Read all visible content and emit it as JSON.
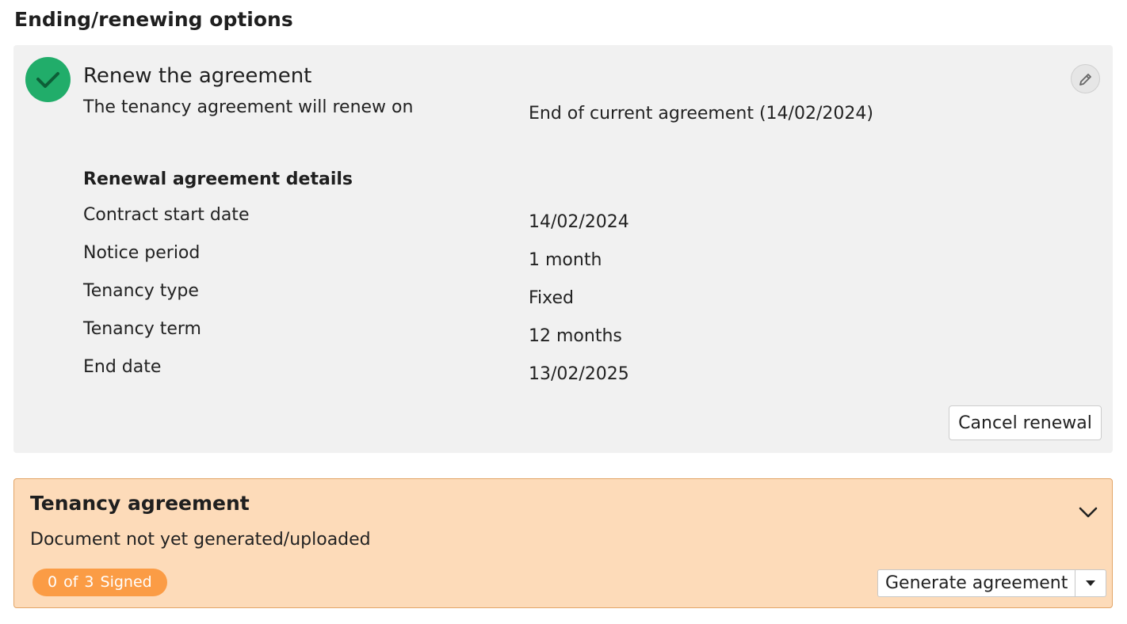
{
  "page": {
    "title": "Ending/renewing options"
  },
  "renewal": {
    "title": "Renew the agreement",
    "status_icon": "check-icon",
    "edit_icon": "pencil-icon",
    "renew_on_label": "The tenancy agreement will renew on",
    "renew_on_value": "End of current agreement (14/02/2024)",
    "details_heading": "Renewal agreement details",
    "rows": [
      {
        "label": "Contract start date",
        "value": "14/02/2024"
      },
      {
        "label": "Notice period",
        "value": "1 month"
      },
      {
        "label": "Tenancy type",
        "value": "Fixed"
      },
      {
        "label": "Tenancy term",
        "value": "12 months"
      },
      {
        "label": "End date",
        "value": "13/02/2025"
      }
    ],
    "cancel_label": "Cancel renewal"
  },
  "agreement": {
    "title": "Tenancy agreement",
    "status": "Document not yet generated/uploaded",
    "expand_icon": "chevron-down-icon",
    "badge": {
      "signed_count": "0",
      "of": "of",
      "total": "3",
      "label": "Signed"
    },
    "generate_label": "Generate agreement",
    "dropdown_icon": "caret-down-icon"
  },
  "colors": {
    "success": "#21ad6a",
    "panel_bg": "#f1f1f1",
    "warning_bg": "#fddbb9",
    "warning_border": "#e3a567",
    "badge": "#fb9c45"
  }
}
